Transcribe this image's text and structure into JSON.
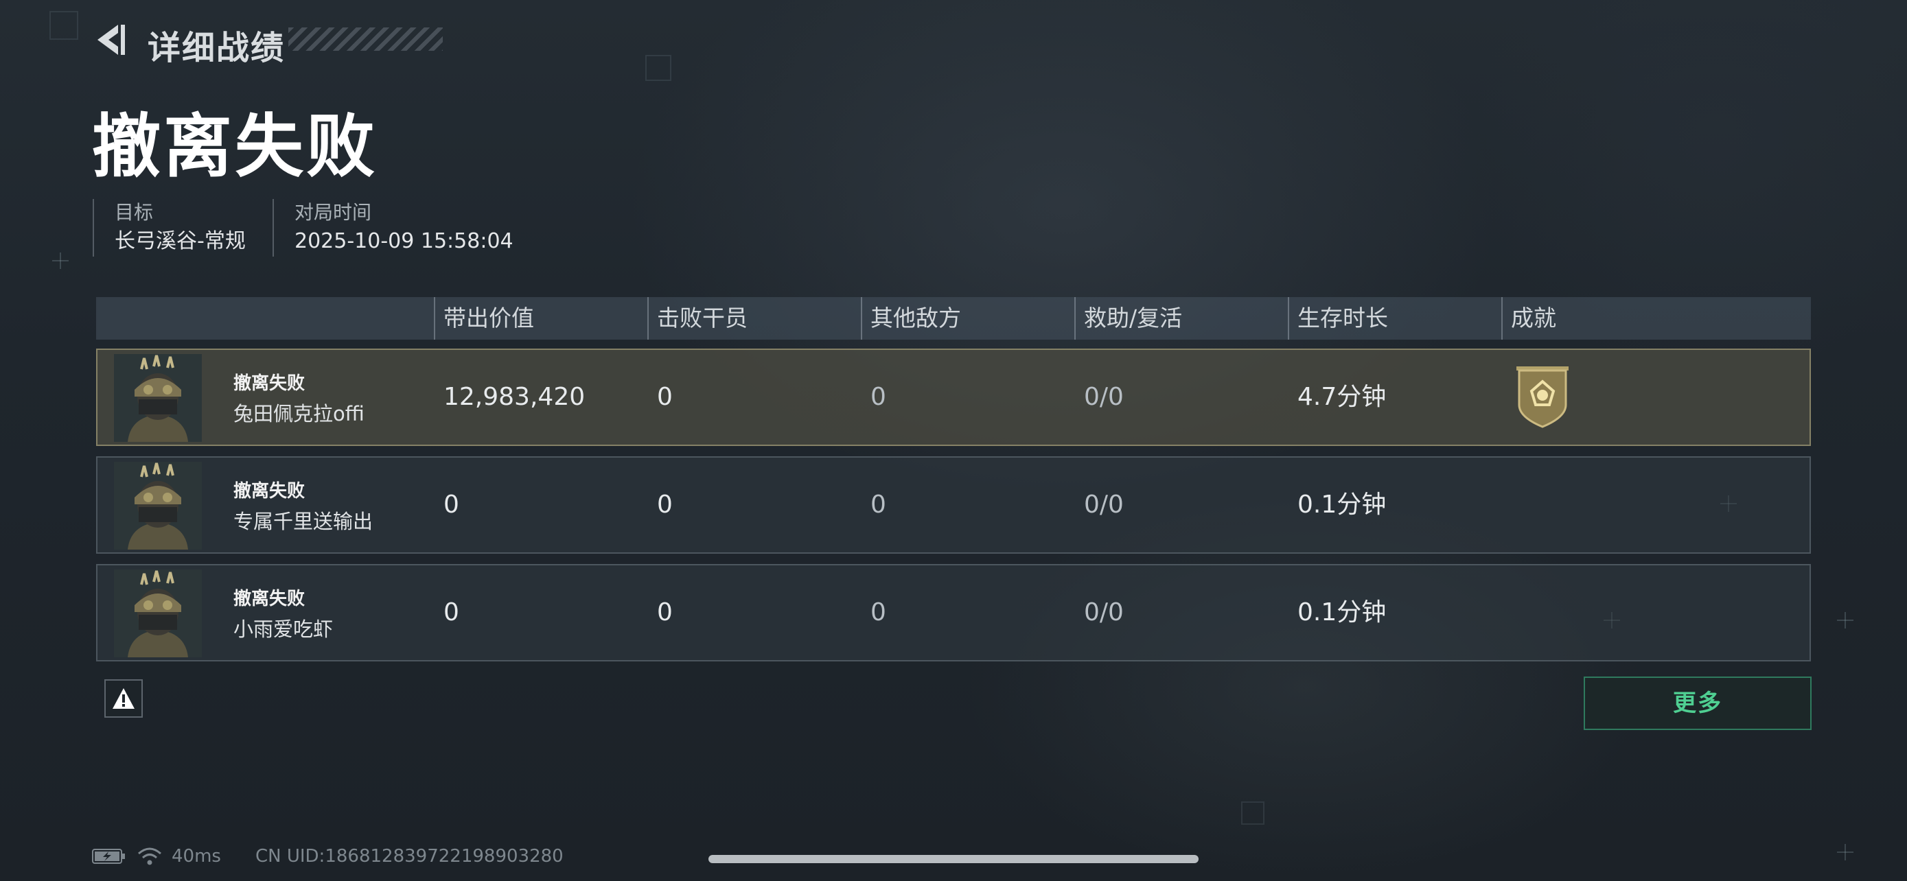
{
  "header": {
    "title": "详细战绩",
    "back_icon": "chevron-left-icon"
  },
  "result": {
    "title": "撤离失败"
  },
  "info": {
    "target_label": "目标",
    "target_value": "长弓溪谷-常规",
    "time_label": "对局时间",
    "time_value": "2025-10-09 15:58:04"
  },
  "table": {
    "columns": [
      "带出价值",
      "击败干员",
      "其他敌方",
      "救助/复活",
      "生存时长",
      "成就"
    ],
    "rows": [
      {
        "status": "撤离失败",
        "name": "兔田佩克拉offi",
        "value": "12,983,420",
        "kills": "0",
        "other": "0",
        "assist": "0/0",
        "survival": "4.7分钟",
        "achievement_icon": "shield-medal-icon",
        "highlighted": true
      },
      {
        "status": "撤离失败",
        "name": "专属千里送输出",
        "value": "0",
        "kills": "0",
        "other": "0",
        "assist": "0/0",
        "survival": "0.1分钟",
        "achievement_icon": "",
        "highlighted": false
      },
      {
        "status": "撤离失败",
        "name": "小雨爱吃虾",
        "value": "0",
        "kills": "0",
        "other": "0",
        "assist": "0/0",
        "survival": "0.1分钟",
        "achievement_icon": "",
        "highlighted": false
      }
    ]
  },
  "actions": {
    "report_icon": "warning-icon",
    "more_label": "更多"
  },
  "status_bar": {
    "battery_icon": "battery-charging-icon",
    "wifi_icon": "wifi-icon",
    "ping": "40ms",
    "uid": "CN UID:1868128397221989032​80"
  },
  "colors": {
    "accent_green": "#4fcf92",
    "highlight_border": "#b4ac82"
  }
}
